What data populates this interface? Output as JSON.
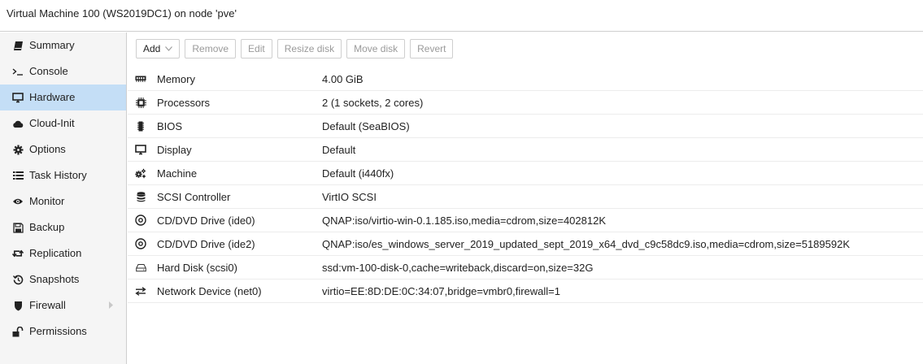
{
  "window": {
    "title": "Virtual Machine 100 (WS2019DC1) on node 'pve'"
  },
  "sidebar": {
    "items": [
      {
        "label": "Summary",
        "icon": "book-icon"
      },
      {
        "label": "Console",
        "icon": "terminal-icon"
      },
      {
        "label": "Hardware",
        "icon": "desktop-icon",
        "active": true
      },
      {
        "label": "Cloud-Init",
        "icon": "cloud-icon"
      },
      {
        "label": "Options",
        "icon": "gear-icon"
      },
      {
        "label": "Task History",
        "icon": "list-icon"
      },
      {
        "label": "Monitor",
        "icon": "eye-icon"
      },
      {
        "label": "Backup",
        "icon": "floppy-icon"
      },
      {
        "label": "Replication",
        "icon": "retweet-icon"
      },
      {
        "label": "Snapshots",
        "icon": "history-icon"
      },
      {
        "label": "Firewall",
        "icon": "shield-icon",
        "expandable": true
      },
      {
        "label": "Permissions",
        "icon": "unlock-icon"
      }
    ]
  },
  "toolbar": {
    "add_label": "Add",
    "remove_label": "Remove",
    "edit_label": "Edit",
    "resize_label": "Resize disk",
    "move_label": "Move disk",
    "revert_label": "Revert"
  },
  "hardware": {
    "rows": [
      {
        "key": "Memory",
        "value": "4.00 GiB",
        "icon": "memory-icon"
      },
      {
        "key": "Processors",
        "value": "2 (1 sockets, 2 cores)",
        "icon": "cpu-icon"
      },
      {
        "key": "BIOS",
        "value": "Default (SeaBIOS)",
        "icon": "microchip-icon"
      },
      {
        "key": "Display",
        "value": "Default",
        "icon": "desktop-icon"
      },
      {
        "key": "Machine",
        "value": "Default (i440fx)",
        "icon": "cogs-icon"
      },
      {
        "key": "SCSI Controller",
        "value": "VirtIO SCSI",
        "icon": "database-icon"
      },
      {
        "key": "CD/DVD Drive (ide0)",
        "value": "QNAP:iso/virtio-win-0.1.185.iso,media=cdrom,size=402812K",
        "icon": "cdrom-icon"
      },
      {
        "key": "CD/DVD Drive (ide2)",
        "value": "QNAP:iso/es_windows_server_2019_updated_sept_2019_x64_dvd_c9c58dc9.iso,media=cdrom,size=5189592K",
        "icon": "cdrom-icon"
      },
      {
        "key": "Hard Disk (scsi0)",
        "value": "ssd:vm-100-disk-0,cache=writeback,discard=on,size=32G",
        "icon": "hdd-icon"
      },
      {
        "key": "Network Device (net0)",
        "value": "virtio=EE:8D:DE:0C:34:07,bridge=vmbr0,firewall=1",
        "icon": "exchange-icon"
      }
    ]
  }
}
